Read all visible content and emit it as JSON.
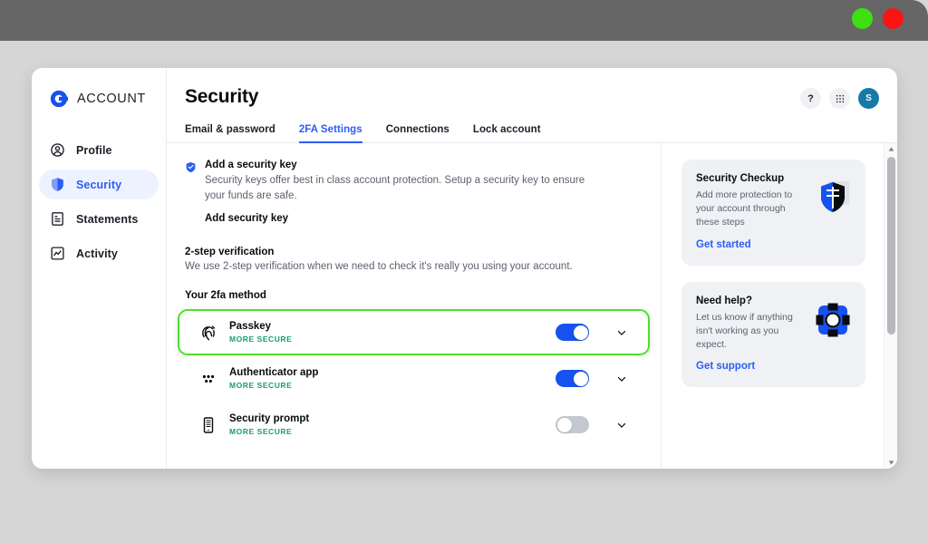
{
  "browser": {
    "buttons": [
      {
        "name": "minimize",
        "color": "#3ee014"
      },
      {
        "name": "close",
        "color": "#fb1414"
      }
    ]
  },
  "sidebar": {
    "brand": "ACCOUNT",
    "brand_icon": "coinbase-logo",
    "items": [
      {
        "label": "Profile",
        "icon": "user-circle-icon",
        "active": false
      },
      {
        "label": "Security",
        "icon": "shield-icon",
        "active": true
      },
      {
        "label": "Statements",
        "icon": "document-icon",
        "active": false
      },
      {
        "label": "Activity",
        "icon": "activity-chart-icon",
        "active": false
      }
    ]
  },
  "header": {
    "title": "Security",
    "actions": [
      {
        "name": "help-button",
        "label": "?"
      },
      {
        "name": "apps-grid-button",
        "label": ""
      },
      {
        "name": "account-avatar",
        "label": "S"
      }
    ]
  },
  "tabs": [
    {
      "label": "Email & password",
      "active": false
    },
    {
      "label": "2FA Settings",
      "active": true
    },
    {
      "label": "Connections",
      "active": false
    },
    {
      "label": "Lock account",
      "active": false
    }
  ],
  "security_key": {
    "icon": "shield-check-icon",
    "title": "Add a security key",
    "description": "Security keys offer best in class account protection. Setup a security key to ensure your funds are safe.",
    "action_label": "Add security key"
  },
  "two_step": {
    "title": "2-step verification",
    "description": "We use 2-step verification when we need to check it's really you using your account.",
    "methods_heading": "Your 2fa method",
    "methods": [
      {
        "name": "Passkey",
        "badge": "MORE SECURE",
        "icon": "fingerprint-icon",
        "enabled": true,
        "selected": true
      },
      {
        "name": "Authenticator app",
        "badge": "MORE SECURE",
        "icon": "dots-grid-icon",
        "enabled": true,
        "selected": false
      },
      {
        "name": "Security prompt",
        "badge": "MORE SECURE",
        "icon": "mobile-phone-icon",
        "enabled": false,
        "selected": false
      }
    ]
  },
  "rail_cards": [
    {
      "title": "Security Checkup",
      "description": "Add more protection to your account through these steps",
      "link": "Get started",
      "icon": "shield-badge-icon"
    },
    {
      "title": "Need help?",
      "description": "Let us know if anything isn't working as you expect.",
      "link": "Get support",
      "icon": "life-ring-icon"
    }
  ],
  "colors": {
    "brand_blue": "#1652f0",
    "link_blue": "#2c5ef5",
    "selected_green": "#4ce226",
    "badge_green": "#179e6f",
    "avatar_teal": "#1878a8",
    "toggle_off": "#c4c9d1"
  }
}
